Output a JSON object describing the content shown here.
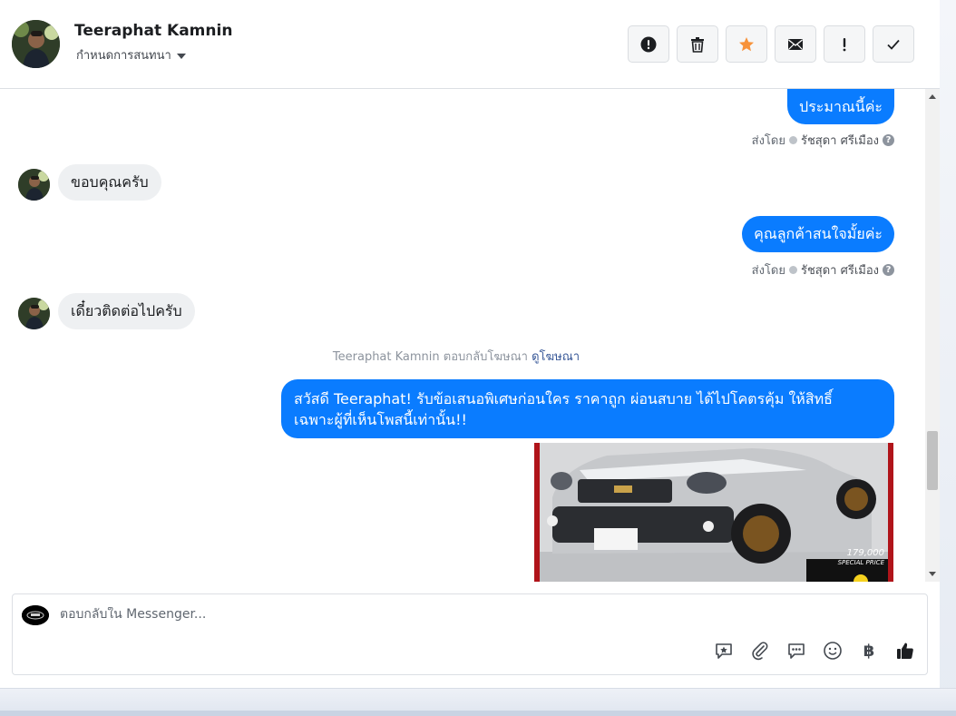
{
  "header": {
    "contact_name": "Teeraphat Kamnin",
    "conversation_settings": "กำหนดการสนทนา",
    "actions": [
      {
        "icon": "alert-circle-icon",
        "name": "report-button"
      },
      {
        "icon": "trash-icon",
        "name": "delete-button"
      },
      {
        "icon": "star-icon",
        "name": "star-button"
      },
      {
        "icon": "envelope-icon",
        "name": "mark-unread-button"
      },
      {
        "icon": "exclamation-icon",
        "name": "spam-button"
      },
      {
        "icon": "checkmark-icon",
        "name": "done-button"
      }
    ]
  },
  "messages": [
    {
      "from": "page",
      "text": "ประมาณนี้ค่ะ",
      "sent_by_label": "ส่งโดย",
      "agent": "รัชสุดา ศรีเมือง"
    },
    {
      "from": "customer",
      "text": "ขอบคุณครับ"
    },
    {
      "from": "page",
      "text": "คุณลูกค้าสนใจมั้ยค่ะ",
      "sent_by_label": "ส่งโดย",
      "agent": "รัชสุดา ศรีเมือง"
    },
    {
      "from": "customer",
      "text": "เดี๋ยวติดต่อไปครับ"
    }
  ],
  "ad_reply": {
    "note": "Teeraphat Kamnin ตอบกลับโฆษณา",
    "link": "ดูโฆษณา",
    "line1": "สวัสดี Teeraphat! รับข้อเสนอพิเศษก่อนใคร ราคาถูก ผ่อนสบาย ได้ไปโคตรคุ้ม ให้สิทธิ์",
    "line2": "เฉพาะผู้ที่เห็นโพสนี้เท่านั้น!!",
    "price": "179,000",
    "price_label": "SPECIAL PRICE"
  },
  "composer": {
    "placeholder": "ตอบกลับใน Messenger...",
    "tools": [
      "saved-reply-icon",
      "attachment-icon",
      "quick-reply-icon",
      "emoji-icon",
      "baht-icon",
      "thumbs-up-icon"
    ],
    "baht_symbol": "฿"
  },
  "colors": {
    "outgoing_bubble": "#0a7cff",
    "incoming_bubble": "#eef0f2",
    "star": "#f7923a"
  }
}
